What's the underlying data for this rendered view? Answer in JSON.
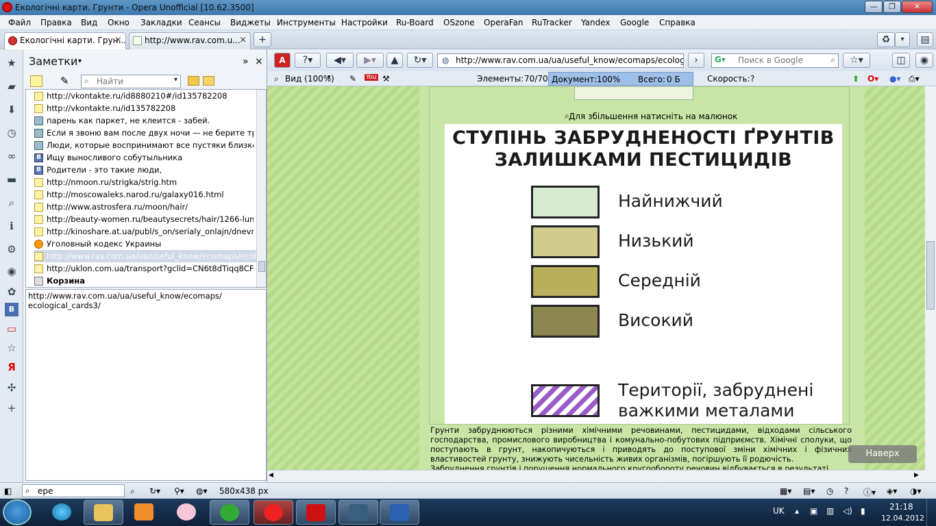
{
  "window": {
    "title": "Екологічні карти. Грунти - Opera Unofficial [10.62.3500]",
    "minimize": "—",
    "maximize": "❐",
    "close": "✕"
  },
  "menu": [
    "Файл",
    "Правка",
    "Вид",
    "Окно",
    "Закладки",
    "Сеансы",
    "Виджеты",
    "Инструменты",
    "Настройки",
    "Ru-Board",
    "OSzone",
    "OperaFan",
    "RuTracker",
    "Yandex",
    "Google",
    "Справка"
  ],
  "tabs": [
    {
      "label": "Екологічні карти. Грун...",
      "active": true
    },
    {
      "label": "http://www.rav.com.u...",
      "active": false
    }
  ],
  "notes": {
    "title": "Заметки",
    "find_placeholder": "Найти",
    "items": [
      {
        "text": "http://vkontakte.ru/id8880210#/id135782208",
        "icon": "note"
      },
      {
        "text": "http://vkontakte.ru/id135782208",
        "icon": "note"
      },
      {
        "text": "парень как паркет, не клеится - забей.",
        "icon": "pic"
      },
      {
        "text": "Если я звоню вам после двух ночи — не берите трубк...",
        "icon": "pic"
      },
      {
        "text": "Люди, которые воспринимают все пустяки близко к ...",
        "icon": "pic"
      },
      {
        "text": "Ищу выносливого собутыльника",
        "icon": "vk"
      },
      {
        "text": "Родители - это такие люди,",
        "icon": "vk"
      },
      {
        "text": "http://nmoon.ru/strigka/strig.htm",
        "icon": "note"
      },
      {
        "text": "http://moscowaleks.narod.ru/galaxy016.html",
        "icon": "note"
      },
      {
        "text": "http://www.astrosfera.ru/moon/hair/",
        "icon": "note"
      },
      {
        "text": "http://beauty-women.ru/beautysecrets/hair/1266-lunny...",
        "icon": "note"
      },
      {
        "text": "http://kinoshare.at.ua/publ/s_on/serialy_onlajn/dnevnik...",
        "icon": "note"
      },
      {
        "text": "Уголовный кодекс Украины",
        "icon": "pic"
      },
      {
        "text": "http://www.rav.com.ua/ua/useful_know/ecomaps/ecol...",
        "icon": "note",
        "selected": true
      },
      {
        "text": "http://uklon.com.ua/transport?gclid=CN6t8dTiqq8CFU...",
        "icon": "note"
      }
    ],
    "trash": "Корзина",
    "note_text": "http://www.rav.com.ua/ua/useful_know/ecomaps/\necological_cards3/"
  },
  "nav": {
    "url": "http://www.rav.com.ua/ua/useful_know/ecomaps/ecological",
    "search_placeholder": "Поиск в Google"
  },
  "status": {
    "view": "Вид (100%)",
    "elements_label": "Элементы:",
    "elements_value": "70/70",
    "document_label": "Документ:",
    "document_value": "100%",
    "total_label": "Всего:",
    "total_value": "0 Б",
    "speed_label": "Скорость:",
    "speed_value": "?"
  },
  "page": {
    "caption": "Для збільшення натисніть на малюнок",
    "legend_title_1": "СТУПІНЬ ЗАБРУДНЕНОСТІ ҐРУНТІВ",
    "legend_title_2": "ЗАЛИШКАМИ ПЕСТИЦИДІВ",
    "levels": [
      {
        "label": "Найнижчий",
        "color": "#d6ebd2"
      },
      {
        "label": "Низький",
        "color": "#cfcc8e"
      },
      {
        "label": "Середній",
        "color": "#b8b05c"
      },
      {
        "label": "Високий",
        "color": "#8c8750"
      }
    ],
    "metals_label_1": "Території, забруднені",
    "metals_label_2": "важкими металами",
    "paragraph": "Грунти забруднюються різними хімічними речовинами, пестицидами, відходами сільського господарства, промислового виробництва і комунально-побутових підприємств. Хімічні сполуки, що поступають в грунт, накопичуються і приводять до поступової зміни хімічних і фізичних властивостей грунту, знижують чисельність живих організмів, погіршують її родючість.",
    "paragraph2": "Забруднення грунтів і порушення нормального кругообороту речовин відбувається в результаті",
    "top_button": "Наверх"
  },
  "bottom": {
    "search_value": "ере",
    "image_size": "580x438 px"
  },
  "tray": {
    "lang": "UK",
    "time": "21:18",
    "date": "12.04.2012"
  }
}
